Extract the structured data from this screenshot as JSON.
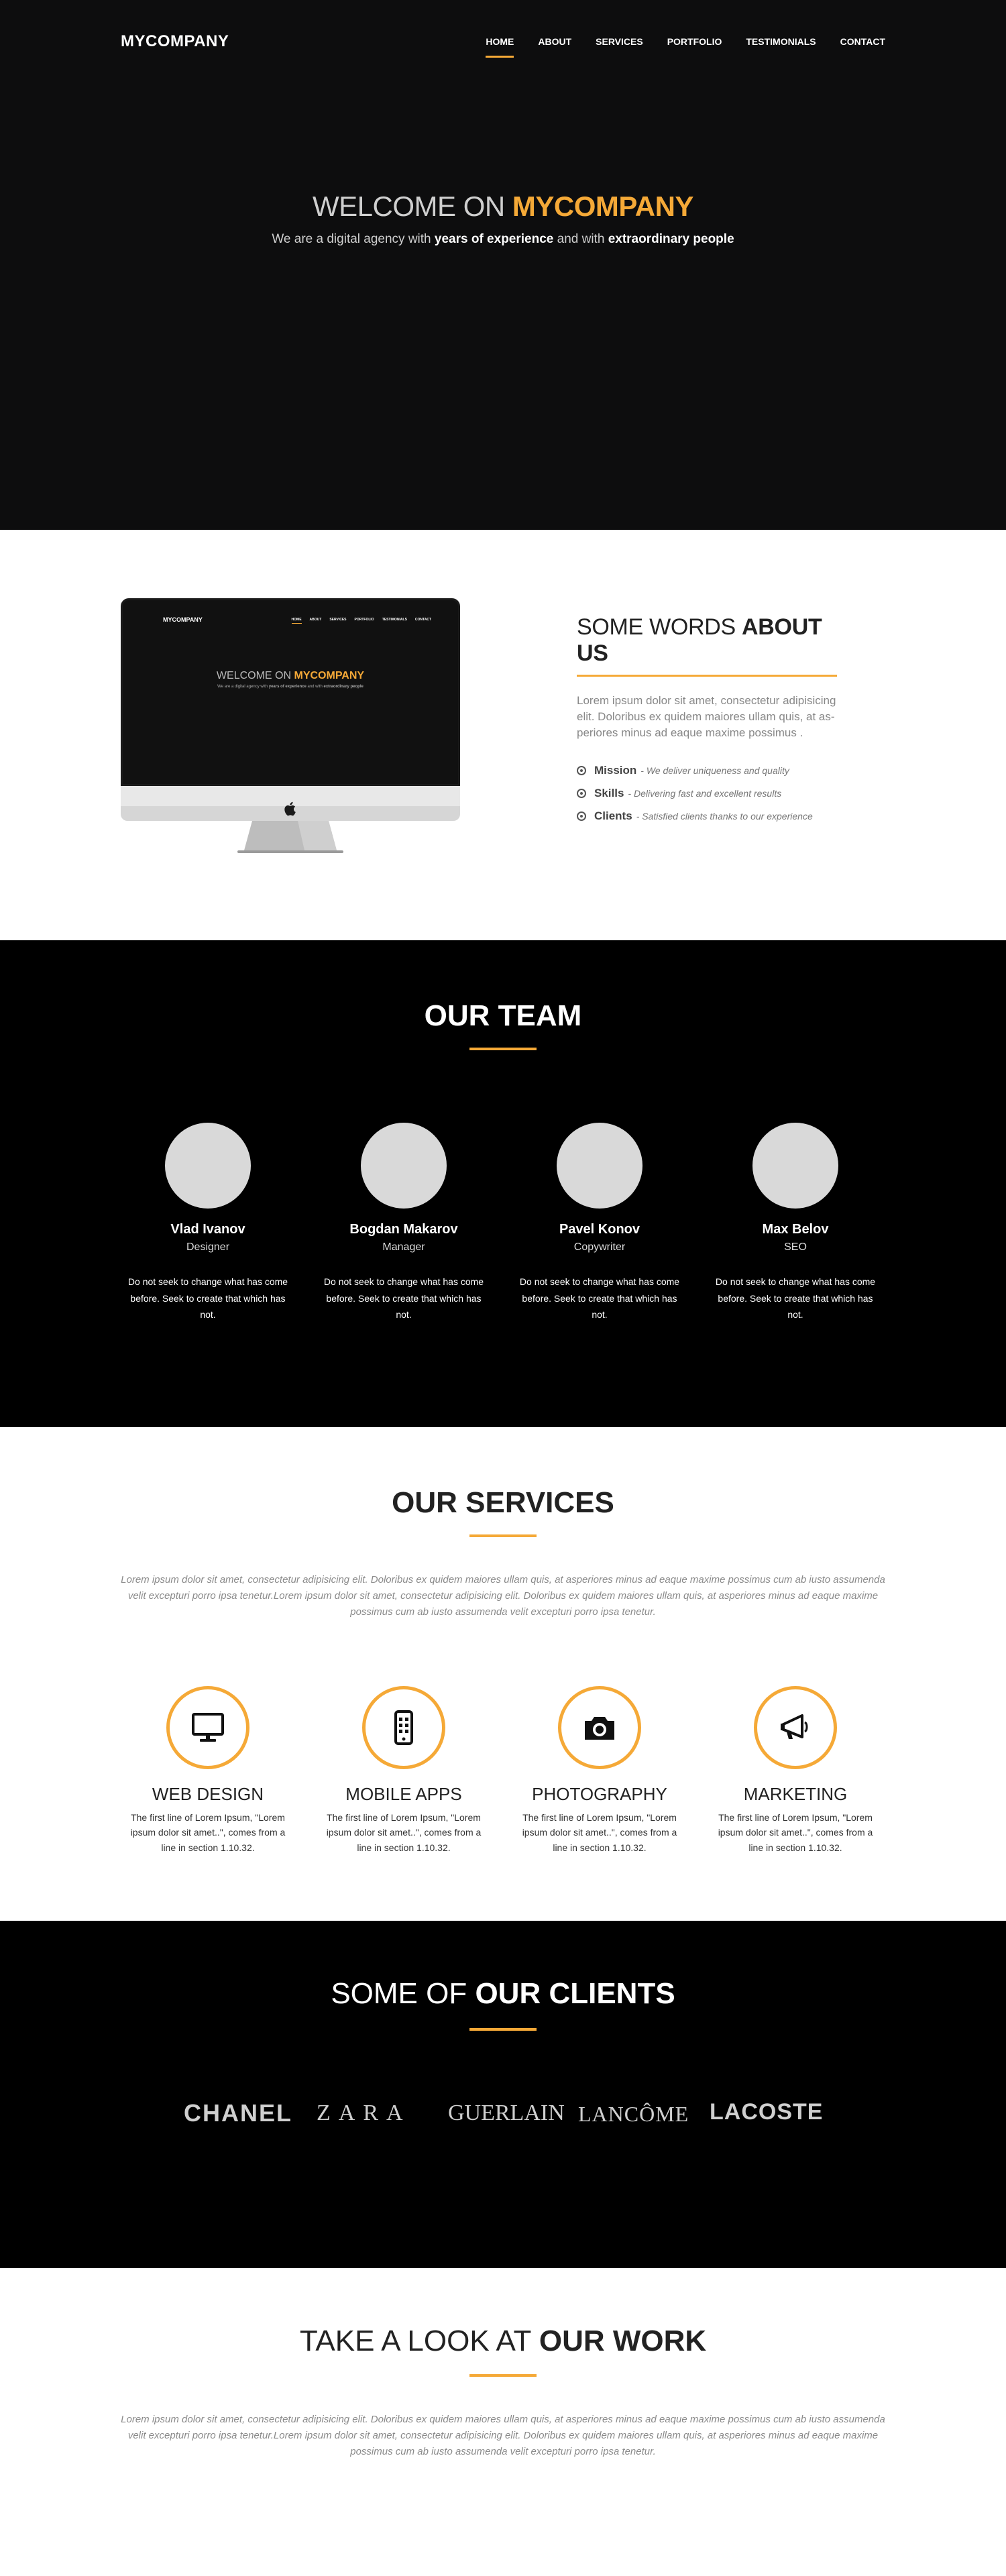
{
  "nav": {
    "brand": "MYCOMPANY",
    "items": [
      "HOME",
      "ABOUT",
      "SERVICES",
      "PORTFOLIO",
      "TESTIMONIALS",
      "CONTACT"
    ],
    "active_index": 0
  },
  "hero": {
    "title_prefix": "WELCOME ON ",
    "title_highlight": "MYCOMPANY",
    "subtitle_1": "We are a digital agency with ",
    "subtitle_bold_1": "years of experience",
    "subtitle_2": " and with ",
    "subtitle_bold_2": "extraordinary people"
  },
  "about": {
    "title_prefix": "SOME WORDS ",
    "title_bold": "ABOUT US",
    "text": "Lorem ipsum dolor sit amet, consectetur adipisicing elit. Doloribus ex quidem maiores ullam quis, at as-periores minus ad eaque maxime possimus .",
    "items": [
      {
        "label": "Mission",
        "desc": "We deliver uniqueness and quality"
      },
      {
        "label": "Skills",
        "desc": "Delivering fast and excellent results"
      },
      {
        "label": "Clients",
        "desc": "Satisfied clients thanks to our experience"
      }
    ]
  },
  "team": {
    "title": "OUR TEAM",
    "members": [
      {
        "name": "Vlad Ivanov",
        "role": "Designer",
        "bio": "Do not seek to change what has come before. Seek to create that which has not."
      },
      {
        "name": "Bogdan Makarov",
        "role": "Manager",
        "bio": "Do not seek to change what has come before. Seek to create that which has not."
      },
      {
        "name": "Pavel Konov",
        "role": "Copywriter",
        "bio": "Do not seek to change what has come before. Seek to create that which has not."
      },
      {
        "name": "Max Belov",
        "role": "SEO",
        "bio": "Do not seek to change what has come before. Seek to create that which has not."
      }
    ]
  },
  "services": {
    "title": "OUR SERVICES",
    "lead": "Lorem ipsum dolor sit amet, consectetur adipisicing elit. Doloribus ex quidem maiores ullam quis, at asperiores minus ad eaque maxime possimus cum ab iusto assumenda velit excepturi porro ipsa tenetur.Lorem ipsum dolor sit amet, consectetur adipisicing elit. Doloribus ex quidem maiores ullam quis, at asperiores minus ad eaque maxime possimus cum ab iusto assumenda velit excepturi porro ipsa tenetur.",
    "items": [
      {
        "title": "WEB DESIGN",
        "icon": "monitor-icon",
        "desc": "The first line of Lorem Ipsum, \"Lorem ipsum dolor sit amet..\", comes from a line in section 1.10.32."
      },
      {
        "title": "MOBILE APPS",
        "icon": "mobile-icon",
        "desc": "The first line of Lorem Ipsum, \"Lorem ipsum dolor sit amet..\", comes from a line in section 1.10.32."
      },
      {
        "title": "PHOTOGRAPHY",
        "icon": "camera-icon",
        "desc": "The first line of Lorem Ipsum, \"Lorem ipsum dolor sit amet..\", comes from a line in section 1.10.32."
      },
      {
        "title": "MARKETING",
        "icon": "megaphone-icon",
        "desc": "The first line of Lorem Ipsum, \"Lorem ipsum dolor sit amet..\", comes from a line in section 1.10.32."
      }
    ]
  },
  "clients": {
    "title_prefix": "SOME OF ",
    "title_bold": "OUR CLIENTS",
    "logos": [
      "CHANEL",
      "ZARA",
      "GUERLAIN",
      "LANCÔME",
      "LACOSTE"
    ]
  },
  "work": {
    "title_prefix": "TAKE A LOOK AT ",
    "title_bold": "OUR WORK",
    "lead": "Lorem ipsum dolor sit amet, consectetur adipisicing elit. Doloribus ex quidem maiores ullam quis, at asperiores minus ad eaque maxime possimus cum ab iusto assumenda velit excepturi porro ipsa tenetur.Lorem ipsum dolor sit amet, consectetur adipisicing elit. Doloribus ex quidem maiores ullam quis, at asperiores minus ad eaque maxime possimus cum ab iusto assumenda velit excepturi porro ipsa tenetur."
  },
  "colors": {
    "accent": "#f5a937",
    "dark_bg": "#000000",
    "hero_bg": "#0d0d0e"
  }
}
